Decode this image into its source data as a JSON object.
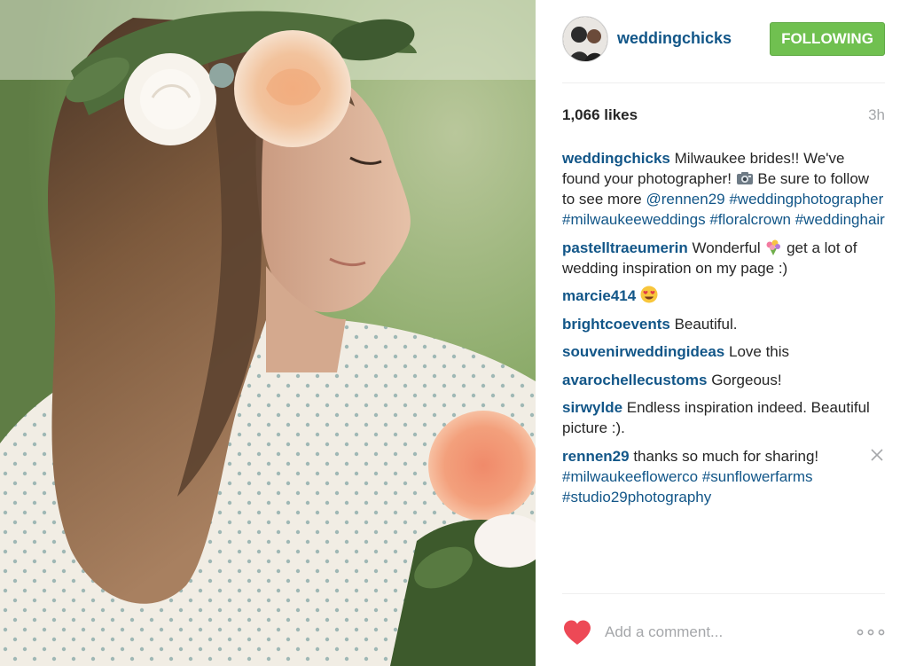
{
  "post": {
    "photo_alt": "",
    "author": {
      "username": "weddingchicks",
      "follow_label": "FOLLOWING"
    },
    "likes_label": "1,066 likes",
    "time_ago": "3h",
    "comments": [
      {
        "author": "weddingchicks",
        "parts": [
          {
            "t": "text",
            "v": " Milwaukee brides!! We've found your photographer! "
          },
          {
            "t": "emoji",
            "v": "camera-emoji"
          },
          {
            "t": "text",
            "v": " Be sure to follow to see more "
          },
          {
            "t": "tag",
            "v": "@rennen29"
          },
          {
            "t": "text",
            "v": " "
          },
          {
            "t": "tag",
            "v": "#weddingphotographer"
          },
          {
            "t": "text",
            "v": " "
          },
          {
            "t": "tag",
            "v": "#milwaukeeweddings"
          },
          {
            "t": "text",
            "v": " "
          },
          {
            "t": "tag",
            "v": "#floralcrown"
          },
          {
            "t": "text",
            "v": " "
          },
          {
            "t": "tag",
            "v": "#weddinghair"
          }
        ]
      },
      {
        "author": "pastelltraeumerin",
        "parts": [
          {
            "t": "text",
            "v": " Wonderful "
          },
          {
            "t": "emoji",
            "v": "bouquet-emoji"
          },
          {
            "t": "text",
            "v": " get a lot of wedding inspiration on my page :)"
          }
        ]
      },
      {
        "author": "marcie414",
        "parts": [
          {
            "t": "text",
            "v": " "
          },
          {
            "t": "emoji",
            "v": "heart-eyes-emoji"
          }
        ]
      },
      {
        "author": "brightcoevents",
        "parts": [
          {
            "t": "text",
            "v": " Beautiful."
          }
        ]
      },
      {
        "author": "souvenirweddingideas",
        "parts": [
          {
            "t": "text",
            "v": " Love this"
          }
        ]
      },
      {
        "author": "avarochellecustoms",
        "parts": [
          {
            "t": "text",
            "v": " Gorgeous!"
          }
        ]
      },
      {
        "author": "sirwylde",
        "parts": [
          {
            "t": "text",
            "v": " Endless inspiration indeed. Beautiful picture :)."
          }
        ]
      },
      {
        "author": "rennen29",
        "deletable": true,
        "parts": [
          {
            "t": "text",
            "v": " thanks so much for sharing! "
          },
          {
            "t": "tag",
            "v": "#milwaukeeflowerco"
          },
          {
            "t": "text",
            "v": " "
          },
          {
            "t": "tag",
            "v": "#sunflowerfarms"
          },
          {
            "t": "text",
            "v": " "
          },
          {
            "t": "tag",
            "v": "#studio29photography"
          }
        ]
      }
    ],
    "comment_input": {
      "value": "",
      "placeholder": "Add a comment..."
    },
    "icons": {
      "like": "heart-icon",
      "more": "more-options-icon",
      "delete": "close-icon"
    },
    "colors": {
      "link": "#125688",
      "follow_button": "#70c050",
      "like_heart": "#ed4956",
      "muted": "#a5a7aa"
    }
  }
}
